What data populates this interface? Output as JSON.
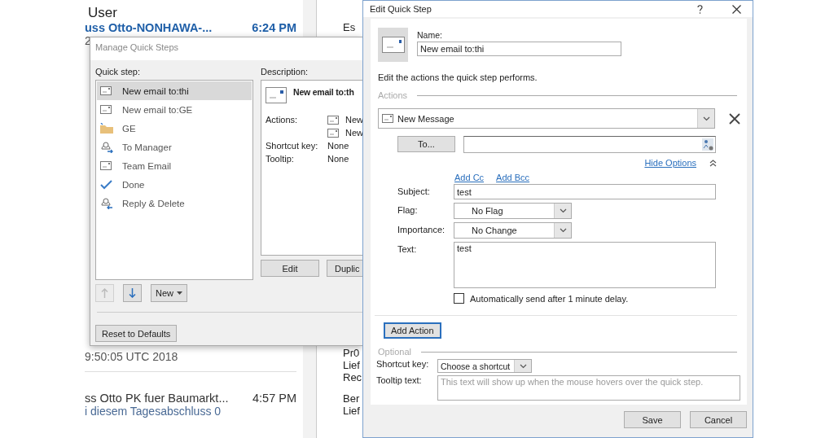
{
  "mail_list": {
    "title": "User",
    "top_message": {
      "subject": "uss Otto-NONHAWA-...",
      "time": "6:24 PM",
      "preview": "2",
      "unread": true
    },
    "lower_messages": [
      {
        "preview": "9:50:05 UTC 2018",
        "unread": false
      },
      {
        "subject": "ss Otto PK fuer Baumarkt...",
        "time": "4:57 PM",
        "preview": "i diesem Tagesabschluss 0",
        "unread": false
      }
    ]
  },
  "reading_pane": {
    "top_line": "Es",
    "paragraphs": [
      [
        "Pr0",
        "Lief",
        "Rec"
      ],
      [
        "Ber",
        "Lief"
      ]
    ]
  },
  "manage_dialog": {
    "title": "Manage Quick Steps",
    "list_label": "Quick step:",
    "steps": [
      {
        "label": "New email to:thi",
        "kind": "email",
        "selected": true
      },
      {
        "label": "New email to:GE",
        "kind": "email",
        "selected": false
      },
      {
        "label": "GE",
        "kind": "folder",
        "selected": false
      },
      {
        "label": "To Manager",
        "kind": "forward",
        "selected": false
      },
      {
        "label": "Team Email",
        "kind": "email",
        "selected": false
      },
      {
        "label": "Done",
        "kind": "check",
        "selected": false
      },
      {
        "label": "Reply & Delete",
        "kind": "reply",
        "selected": false
      }
    ],
    "description_label": "Description:",
    "description": {
      "title": "New email to:th",
      "actions_label": "Actions:",
      "actions": [
        "New",
        "New"
      ],
      "shortcut_label": "Shortcut key:",
      "shortcut": "None",
      "tooltip_label": "Tooltip:",
      "tooltip": "None"
    },
    "buttons": [
      "Edit",
      "Duplic"
    ],
    "move_buttons": [
      {
        "kind": "up",
        "disabled": true
      },
      {
        "kind": "down",
        "disabled": false
      }
    ],
    "new_button": "New",
    "reset_button": "Reset to Defaults"
  },
  "edit_dialog": {
    "title": "Edit Quick Step",
    "name_label": "Name:",
    "name_value": "New email to:thi",
    "instruction": "Edit the actions the quick step performs.",
    "actions_section": "Actions",
    "action": "New Message",
    "to_button": "To...",
    "hide_options": "Hide Options",
    "add_cc": "Add Cc",
    "add_bcc": "Add Bcc",
    "fields": [
      {
        "label": "Subject:",
        "value": "test",
        "kind": "text"
      },
      {
        "label": "Flag:",
        "value": "No Flag",
        "kind": "dropdown"
      },
      {
        "label": "Importance:",
        "value": "No Change",
        "kind": "dropdown"
      },
      {
        "label": "Text:",
        "value": "test",
        "kind": "textarea"
      }
    ],
    "auto_send": {
      "label": "Automatically send after 1 minute delay.",
      "checked": false
    },
    "add_action": {
      "label": "Add Action",
      "focused": true
    },
    "optional_section": "Optional",
    "shortcut_label": "Shortcut key:",
    "shortcut_value": "Choose a shortcut",
    "tooltip_label": "Tooltip text:",
    "tooltip_placeholder": "This text will show up when the mouse hovers over the quick step.",
    "buttons": [
      "Save",
      "Cancel"
    ]
  }
}
